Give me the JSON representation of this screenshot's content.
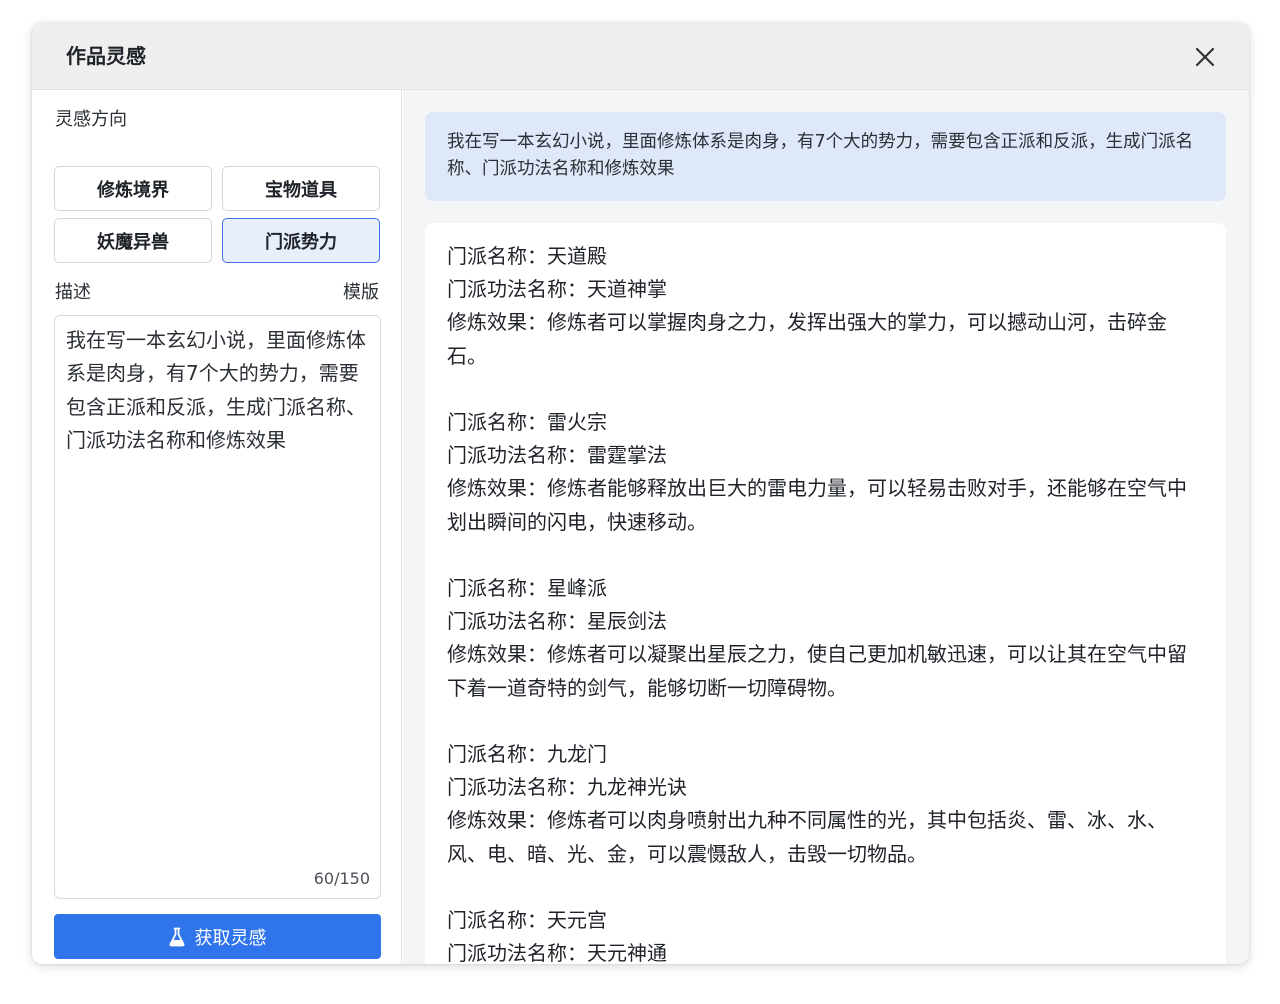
{
  "dialog": {
    "title": "作品灵感",
    "close_icon": "close-icon"
  },
  "left": {
    "direction_label": "灵感方向",
    "categories": [
      {
        "label": "修炼境界",
        "active": false
      },
      {
        "label": "宝物道具",
        "active": false
      },
      {
        "label": "妖魔异兽",
        "active": false
      },
      {
        "label": "门派势力",
        "active": true
      }
    ],
    "description_label": "描述",
    "template_label": "模版",
    "description_value": "我在写一本玄幻小说，里面修炼体系是肉身，有7个大的势力，需要包含正派和反派，生成门派名称、门派功法名称和修炼效果",
    "char_count": "60/150",
    "submit_label": "获取灵感",
    "submit_icon": "flask-icon"
  },
  "right": {
    "prompt": "我在写一本玄幻小说，里面修炼体系是肉身，有7个大的势力，需要包含正派和反派，生成门派名称、门派功法名称和修炼效果",
    "results": [
      {
        "name": "门派名称：天道殿",
        "skill": "门派功法名称：天道神掌",
        "effect": "修炼效果：修炼者可以掌握肉身之力，发挥出强大的掌力，可以撼动山河，击碎金石。"
      },
      {
        "name": "门派名称：雷火宗",
        "skill": "门派功法名称：雷霆掌法",
        "effect": "修炼效果：修炼者能够释放出巨大的雷电力量，可以轻易击败对手，还能够在空气中划出瞬间的闪电，快速移动。"
      },
      {
        "name": "门派名称：星峰派",
        "skill": "门派功法名称：星辰剑法",
        "effect": "修炼效果：修炼者可以凝聚出星辰之力，使自己更加机敏迅速，可以让其在空气中留下着一道奇特的剑气，能够切断一切障碍物。"
      },
      {
        "name": "门派名称：九龙门",
        "skill": "门派功法名称：九龙神光诀",
        "effect": "修炼效果：修炼者可以肉身喷射出九种不同属性的光，其中包括炎、雷、冰、水、风、电、暗、光、金，可以震慑敌人，击毁一切物品。"
      },
      {
        "name": "门派名称：天元宫",
        "skill": "门派功法名称：天元神通",
        "effect": ""
      }
    ]
  },
  "colors": {
    "accent": "#2f74ea",
    "active_bg": "#e7eefc",
    "active_border": "#3f74e0",
    "prompt_bg": "#dfe8f8",
    "panel_bg": "#f4f5f7"
  }
}
